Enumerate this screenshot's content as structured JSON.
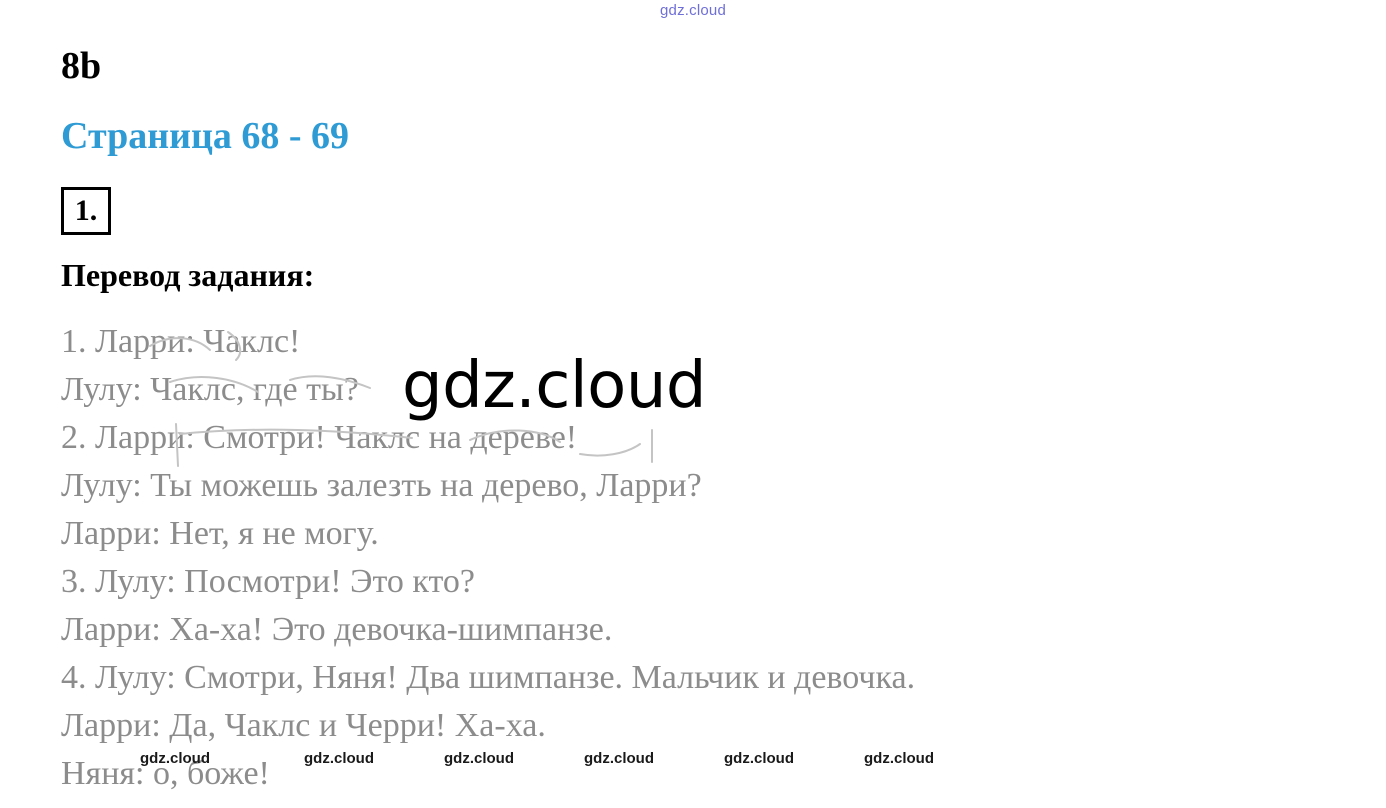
{
  "watermark_top": "gdz.cloud",
  "section_code": "8b",
  "page_heading": "Страница 68 - 69",
  "exercise_number": "1.",
  "task_heading": "Перевод задания:",
  "translation_lines": [
    "1. Ларри: Чаклс!",
    "Лулу: Чаклс, где ты?",
    "2. Ларри: Смотри! Чаклс на дереве!",
    "Лулу: Ты можешь залезть на дерево, Ларри?",
    "Ларри: Нет, я не могу.",
    "3. Лулу: Посмотри! Это кто?",
    "Ларри: Ха-ха! Это девочка-шимпанзе.",
    "4. Лулу: Смотри, Няня! Два шимпанзе. Мальчик и девочка.",
    "Ларри: Да, Чаклс и Черри! Ха-ха.",
    "Няня: о, боже!"
  ],
  "watermark_center": "gdz.cloud",
  "watermarks_bottom": [
    "gdz.cloud",
    "gdz.cloud",
    "gdz.cloud",
    "gdz.cloud",
    "gdz.cloud",
    "gdz.cloud"
  ],
  "colors": {
    "heading_accent": "#2e9bd4",
    "translation_text": "#8c8c8c",
    "top_watermark": "#6f6fd8"
  }
}
